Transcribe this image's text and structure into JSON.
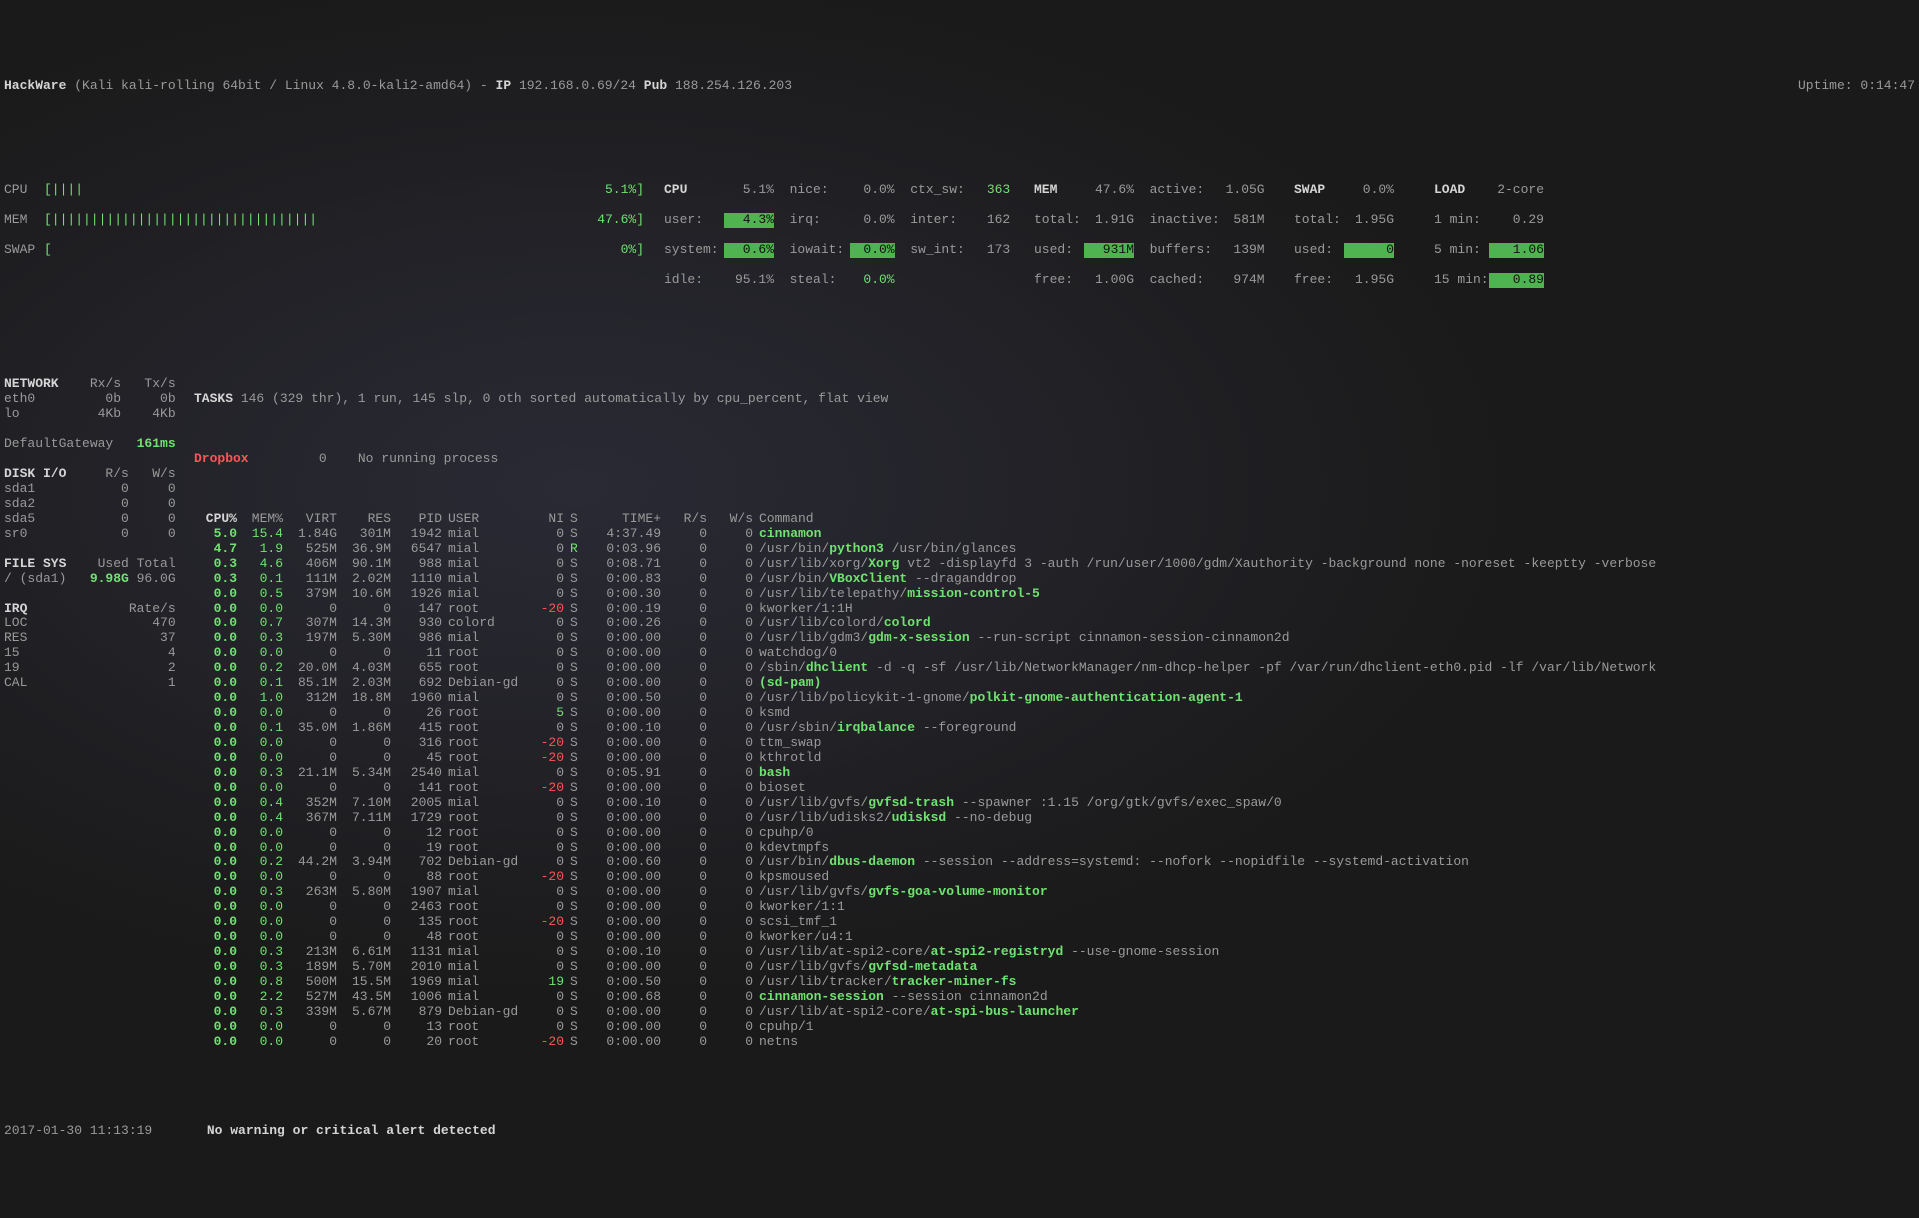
{
  "header": {
    "host": "HackWare",
    "os": "(Kali kali-rolling 64bit / Linux 4.8.0-kali2-amd64)",
    "ip_lbl": "IP",
    "ip": "192.168.0.69/24",
    "pub_lbl": "Pub",
    "pub": "188.254.126.203",
    "uptime_lbl": "Uptime:",
    "uptime": "0:14:47"
  },
  "bars": {
    "cpu": {
      "lbl": "CPU",
      "bar": "[||||",
      "pct": "5.1%]"
    },
    "mem": {
      "lbl": "MEM",
      "bar": "[||||||||||||||||||||||||||||||||||",
      "pct": "47.6%]"
    },
    "swap": {
      "lbl": "SWAP",
      "bar": "[",
      "pct": "0%]"
    }
  },
  "cpu": {
    "hdr": "CPU",
    "tot": "5.1%",
    "user": "user:",
    "user_v": " 4.3%",
    "sys": "system:",
    "sys_v": " 0.6%",
    "idle": "idle:",
    "idle_v": "95.1%",
    "nice": "nice:",
    "nice_v": "0.0%",
    "irq": "irq:",
    "irq_v": "0.0%",
    "iow": "iowait:",
    "iow_v": " 0.0%",
    "steal": "steal:",
    "steal_v": "0.0%",
    "ctx": "ctx_sw:",
    "ctx_v": "363",
    "inter": "inter:",
    "inter_v": "162",
    "swint": "sw_int:",
    "swint_v": "173"
  },
  "mem": {
    "hdr": "MEM",
    "tot": "47.6%",
    "act": "active:",
    "act_v": "1.05G",
    "total": "total:",
    "total_v": "1.91G",
    "inact": "inactive:",
    "inact_v": "581M",
    "used": "used:",
    "used_v": " 931M",
    "buf": "buffers:",
    "buf_v": "139M",
    "free": "free:",
    "free_v": "1.00G",
    "cache": "cached:",
    "cache_v": "974M"
  },
  "swap": {
    "hdr": "SWAP",
    "tot": "0.0%",
    "total": "total:",
    "total_v": "1.95G",
    "used": "used:",
    "used_v": "   0",
    "free": "free:",
    "free_v": "1.95G"
  },
  "load": {
    "hdr": "LOAD",
    "core": "2-core",
    "m1": "1 min:",
    "m1_v": "0.29",
    "m5": "5 min:",
    "m5_v": "1.06",
    "m15": "15 min:",
    "m15_v": "0.89"
  },
  "net": {
    "hdr": "NETWORK",
    "rx": "Rx/s",
    "tx": "Tx/s",
    "ifs": [
      {
        "n": "eth0",
        "r": "0b",
        "t": "0b"
      },
      {
        "n": "lo",
        "r": "4Kb",
        "t": "4Kb"
      }
    ]
  },
  "tasks": {
    "lbl": "TASKS",
    "txt": "146 (329 thr), 1 run, 145 slp, 0 oth sorted automatically by cpu_percent, flat view"
  },
  "dropbox": {
    "lbl": "Dropbox",
    "n": "0",
    "txt": "No running process"
  },
  "gw": {
    "lbl": "DefaultGateway",
    "v": "161ms"
  },
  "disk": {
    "hdr": "DISK I/O",
    "r": "R/s",
    "w": "W/s",
    "rows": [
      {
        "n": "sda1",
        "r": "0",
        "w": "0"
      },
      {
        "n": "sda2",
        "r": "0",
        "w": "0"
      },
      {
        "n": "sda5",
        "r": "0",
        "w": "0"
      },
      {
        "n": "sr0",
        "r": "0",
        "w": "0"
      }
    ]
  },
  "fs": {
    "hdr": "FILE SYS",
    "u": "Used",
    "t": "Total",
    "rows": [
      {
        "n": "/ (sda1)",
        "u": "9.98G",
        "t": "96.0G"
      }
    ]
  },
  "irq": {
    "hdr": "IRQ",
    "rate": "Rate/s",
    "rows": [
      {
        "n": "LOC",
        "v": "470"
      },
      {
        "n": "RES",
        "v": "37"
      },
      {
        "n": "15",
        "v": "4"
      },
      {
        "n": "19",
        "v": "2"
      },
      {
        "n": "CAL",
        "v": "1"
      }
    ]
  },
  "phdr": {
    "cpu": "CPU%",
    "mem": "MEM%",
    "virt": "VIRT",
    "res": "RES",
    "pid": "PID",
    "user": "USER",
    "ni": "NI",
    "s": "S",
    "time": "TIME+",
    "rs": "R/s",
    "ws": "W/s",
    "cmd": "Command"
  },
  "procs": [
    {
      "cpu": "5.0",
      "mem": "15.4",
      "virt": "1.84G",
      "res": "301M",
      "pid": "1942",
      "user": "mial",
      "ni": "0",
      "s": "S",
      "time": "4:37.49",
      "rs": "0",
      "ws": "0",
      "cmd": [
        [
          "g",
          "cinnamon"
        ]
      ]
    },
    {
      "cpu": "4.7",
      "mem": "1.9",
      "virt": "525M",
      "res": "36.9M",
      "pid": "6547",
      "user": "mial",
      "ni": "0",
      "s": "R",
      "time": "0:03.96",
      "rs": "0",
      "ws": "0",
      "cmd": [
        [
          "d",
          "/usr/bin/"
        ],
        [
          "g",
          "python3"
        ],
        [
          "d",
          " /usr/bin/glances"
        ]
      ]
    },
    {
      "cpu": "0.3",
      "mem": "4.6",
      "virt": "406M",
      "res": "90.1M",
      "pid": "988",
      "user": "mial",
      "ni": "0",
      "s": "S",
      "time": "0:08.71",
      "rs": "0",
      "ws": "0",
      "cmd": [
        [
          "d",
          "/usr/lib/xorg/"
        ],
        [
          "g",
          "Xorg"
        ],
        [
          "d",
          " vt2 -displayfd 3 -auth /run/user/1000/gdm/Xauthority -background none -noreset -keeptty -verbose"
        ]
      ]
    },
    {
      "cpu": "0.3",
      "mem": "0.1",
      "virt": "111M",
      "res": "2.02M",
      "pid": "1110",
      "user": "mial",
      "ni": "0",
      "s": "S",
      "time": "0:00.83",
      "rs": "0",
      "ws": "0",
      "cmd": [
        [
          "d",
          "/usr/bin/"
        ],
        [
          "g",
          "VBoxClient"
        ],
        [
          "d",
          " --draganddrop"
        ]
      ]
    },
    {
      "cpu": "0.0",
      "mem": "0.5",
      "virt": "379M",
      "res": "10.6M",
      "pid": "1926",
      "user": "mial",
      "ni": "0",
      "s": "S",
      "time": "0:00.30",
      "rs": "0",
      "ws": "0",
      "cmd": [
        [
          "d",
          "/usr/lib/telepathy/"
        ],
        [
          "g",
          "mission-control-5"
        ]
      ]
    },
    {
      "cpu": "0.0",
      "mem": "0.0",
      "virt": "0",
      "res": "0",
      "pid": "147",
      "user": "root",
      "ni": "-20",
      "s": "S",
      "time": "0:00.19",
      "rs": "0",
      "ws": "0",
      "cmd": [
        [
          "d",
          "kworker/1:1H"
        ]
      ]
    },
    {
      "cpu": "0.0",
      "mem": "0.7",
      "virt": "307M",
      "res": "14.3M",
      "pid": "930",
      "user": "colord",
      "ni": "0",
      "s": "S",
      "time": "0:00.26",
      "rs": "0",
      "ws": "0",
      "cmd": [
        [
          "d",
          "/usr/lib/colord/"
        ],
        [
          "g",
          "colord"
        ]
      ]
    },
    {
      "cpu": "0.0",
      "mem": "0.3",
      "virt": "197M",
      "res": "5.30M",
      "pid": "986",
      "user": "mial",
      "ni": "0",
      "s": "S",
      "time": "0:00.00",
      "rs": "0",
      "ws": "0",
      "cmd": [
        [
          "d",
          "/usr/lib/gdm3/"
        ],
        [
          "g",
          "gdm-x-session"
        ],
        [
          "d",
          " --run-script cinnamon-session-cinnamon2d"
        ]
      ]
    },
    {
      "cpu": "0.0",
      "mem": "0.0",
      "virt": "0",
      "res": "0",
      "pid": "11",
      "user": "root",
      "ni": "0",
      "s": "S",
      "time": "0:00.00",
      "rs": "0",
      "ws": "0",
      "cmd": [
        [
          "d",
          "watchdog/0"
        ]
      ]
    },
    {
      "cpu": "0.0",
      "mem": "0.2",
      "virt": "20.0M",
      "res": "4.03M",
      "pid": "655",
      "user": "root",
      "ni": "0",
      "s": "S",
      "time": "0:00.00",
      "rs": "0",
      "ws": "0",
      "cmd": [
        [
          "d",
          "/sbin/"
        ],
        [
          "g",
          "dhclient"
        ],
        [
          "d",
          " -d -q -sf /usr/lib/NetworkManager/nm-dhcp-helper -pf /var/run/dhclient-eth0.pid -lf /var/lib/Network"
        ]
      ]
    },
    {
      "cpu": "0.0",
      "mem": "0.1",
      "virt": "85.1M",
      "res": "2.03M",
      "pid": "692",
      "user": "Debian-gd",
      "ni": "0",
      "s": "S",
      "time": "0:00.00",
      "rs": "0",
      "ws": "0",
      "cmd": [
        [
          "g",
          "(sd-pam)"
        ]
      ]
    },
    {
      "cpu": "0.0",
      "mem": "1.0",
      "virt": "312M",
      "res": "18.8M",
      "pid": "1960",
      "user": "mial",
      "ni": "0",
      "s": "S",
      "time": "0:00.50",
      "rs": "0",
      "ws": "0",
      "cmd": [
        [
          "d",
          "/usr/lib/policykit-1-gnome/"
        ],
        [
          "g",
          "polkit-gnome-authentication-agent-1"
        ]
      ]
    },
    {
      "cpu": "0.0",
      "mem": "0.0",
      "virt": "0",
      "res": "0",
      "pid": "26",
      "user": "root",
      "ni": "5",
      "s": "S",
      "time": "0:00.00",
      "rs": "0",
      "ws": "0",
      "cmd": [
        [
          "d",
          "ksmd"
        ]
      ]
    },
    {
      "cpu": "0.0",
      "mem": "0.1",
      "virt": "35.0M",
      "res": "1.86M",
      "pid": "415",
      "user": "root",
      "ni": "0",
      "s": "S",
      "time": "0:00.10",
      "rs": "0",
      "ws": "0",
      "cmd": [
        [
          "d",
          "/usr/sbin/"
        ],
        [
          "g",
          "irqbalance"
        ],
        [
          "d",
          " --foreground"
        ]
      ]
    },
    {
      "cpu": "0.0",
      "mem": "0.0",
      "virt": "0",
      "res": "0",
      "pid": "316",
      "user": "root",
      "ni": "-20",
      "s": "S",
      "time": "0:00.00",
      "rs": "0",
      "ws": "0",
      "cmd": [
        [
          "d",
          "ttm_swap"
        ]
      ]
    },
    {
      "cpu": "0.0",
      "mem": "0.0",
      "virt": "0",
      "res": "0",
      "pid": "45",
      "user": "root",
      "ni": "-20",
      "s": "S",
      "time": "0:00.00",
      "rs": "0",
      "ws": "0",
      "cmd": [
        [
          "d",
          "kthrotld"
        ]
      ]
    },
    {
      "cpu": "0.0",
      "mem": "0.3",
      "virt": "21.1M",
      "res": "5.34M",
      "pid": "2540",
      "user": "mial",
      "ni": "0",
      "s": "S",
      "time": "0:05.91",
      "rs": "0",
      "ws": "0",
      "cmd": [
        [
          "g",
          "bash"
        ]
      ]
    },
    {
      "cpu": "0.0",
      "mem": "0.0",
      "virt": "0",
      "res": "0",
      "pid": "141",
      "user": "root",
      "ni": "-20",
      "s": "S",
      "time": "0:00.00",
      "rs": "0",
      "ws": "0",
      "cmd": [
        [
          "d",
          "bioset"
        ]
      ]
    },
    {
      "cpu": "0.0",
      "mem": "0.4",
      "virt": "352M",
      "res": "7.10M",
      "pid": "2005",
      "user": "mial",
      "ni": "0",
      "s": "S",
      "time": "0:00.10",
      "rs": "0",
      "ws": "0",
      "cmd": [
        [
          "d",
          "/usr/lib/gvfs/"
        ],
        [
          "g",
          "gvfsd-trash"
        ],
        [
          "d",
          " --spawner :1.15 /org/gtk/gvfs/exec_spaw/0"
        ]
      ]
    },
    {
      "cpu": "0.0",
      "mem": "0.4",
      "virt": "367M",
      "res": "7.11M",
      "pid": "1729",
      "user": "root",
      "ni": "0",
      "s": "S",
      "time": "0:00.00",
      "rs": "0",
      "ws": "0",
      "cmd": [
        [
          "d",
          "/usr/lib/udisks2/"
        ],
        [
          "g",
          "udisksd"
        ],
        [
          "d",
          " --no-debug"
        ]
      ]
    },
    {
      "cpu": "0.0",
      "mem": "0.0",
      "virt": "0",
      "res": "0",
      "pid": "12",
      "user": "root",
      "ni": "0",
      "s": "S",
      "time": "0:00.00",
      "rs": "0",
      "ws": "0",
      "cmd": [
        [
          "d",
          "cpuhp/0"
        ]
      ]
    },
    {
      "cpu": "0.0",
      "mem": "0.0",
      "virt": "0",
      "res": "0",
      "pid": "19",
      "user": "root",
      "ni": "0",
      "s": "S",
      "time": "0:00.00",
      "rs": "0",
      "ws": "0",
      "cmd": [
        [
          "d",
          "kdevtmpfs"
        ]
      ]
    },
    {
      "cpu": "0.0",
      "mem": "0.2",
      "virt": "44.2M",
      "res": "3.94M",
      "pid": "702",
      "user": "Debian-gd",
      "ni": "0",
      "s": "S",
      "time": "0:00.60",
      "rs": "0",
      "ws": "0",
      "cmd": [
        [
          "d",
          "/usr/bin/"
        ],
        [
          "g",
          "dbus-daemon"
        ],
        [
          "d",
          " --session --address=systemd: --nofork --nopidfile --systemd-activation"
        ]
      ]
    },
    {
      "cpu": "0.0",
      "mem": "0.0",
      "virt": "0",
      "res": "0",
      "pid": "88",
      "user": "root",
      "ni": "-20",
      "s": "S",
      "time": "0:00.00",
      "rs": "0",
      "ws": "0",
      "cmd": [
        [
          "d",
          "kpsmoused"
        ]
      ]
    },
    {
      "cpu": "0.0",
      "mem": "0.3",
      "virt": "263M",
      "res": "5.80M",
      "pid": "1907",
      "user": "mial",
      "ni": "0",
      "s": "S",
      "time": "0:00.00",
      "rs": "0",
      "ws": "0",
      "cmd": [
        [
          "d",
          "/usr/lib/gvfs/"
        ],
        [
          "g",
          "gvfs-goa-volume-monitor"
        ]
      ]
    },
    {
      "cpu": "0.0",
      "mem": "0.0",
      "virt": "0",
      "res": "0",
      "pid": "2463",
      "user": "root",
      "ni": "0",
      "s": "S",
      "time": "0:00.00",
      "rs": "0",
      "ws": "0",
      "cmd": [
        [
          "d",
          "kworker/1:1"
        ]
      ]
    },
    {
      "cpu": "0.0",
      "mem": "0.0",
      "virt": "0",
      "res": "0",
      "pid": "135",
      "user": "root",
      "ni": "-20",
      "s": "S",
      "time": "0:00.00",
      "rs": "0",
      "ws": "0",
      "cmd": [
        [
          "d",
          "scsi_tmf_1"
        ]
      ]
    },
    {
      "cpu": "0.0",
      "mem": "0.0",
      "virt": "0",
      "res": "0",
      "pid": "48",
      "user": "root",
      "ni": "0",
      "s": "S",
      "time": "0:00.00",
      "rs": "0",
      "ws": "0",
      "cmd": [
        [
          "d",
          "kworker/u4:1"
        ]
      ]
    },
    {
      "cpu": "0.0",
      "mem": "0.3",
      "virt": "213M",
      "res": "6.61M",
      "pid": "1131",
      "user": "mial",
      "ni": "0",
      "s": "S",
      "time": "0:00.10",
      "rs": "0",
      "ws": "0",
      "cmd": [
        [
          "d",
          "/usr/lib/at-spi2-core/"
        ],
        [
          "g",
          "at-spi2-registryd"
        ],
        [
          "d",
          " --use-gnome-session"
        ]
      ]
    },
    {
      "cpu": "0.0",
      "mem": "0.3",
      "virt": "189M",
      "res": "5.70M",
      "pid": "2010",
      "user": "mial",
      "ni": "0",
      "s": "S",
      "time": "0:00.00",
      "rs": "0",
      "ws": "0",
      "cmd": [
        [
          "d",
          "/usr/lib/gvfs/"
        ],
        [
          "g",
          "gvfsd-metadata"
        ]
      ]
    },
    {
      "cpu": "0.0",
      "mem": "0.8",
      "virt": "500M",
      "res": "15.5M",
      "pid": "1969",
      "user": "mial",
      "ni": "19",
      "s": "S",
      "time": "0:00.50",
      "rs": "0",
      "ws": "0",
      "cmd": [
        [
          "d",
          "/usr/lib/tracker/"
        ],
        [
          "g",
          "tracker-miner-fs"
        ]
      ]
    },
    {
      "cpu": "0.0",
      "mem": "2.2",
      "virt": "527M",
      "res": "43.5M",
      "pid": "1006",
      "user": "mial",
      "ni": "0",
      "s": "S",
      "time": "0:00.68",
      "rs": "0",
      "ws": "0",
      "cmd": [
        [
          "g",
          "cinnamon-session"
        ],
        [
          "d",
          " --session cinnamon2d"
        ]
      ]
    },
    {
      "cpu": "0.0",
      "mem": "0.3",
      "virt": "339M",
      "res": "5.67M",
      "pid": "879",
      "user": "Debian-gd",
      "ni": "0",
      "s": "S",
      "time": "0:00.00",
      "rs": "0",
      "ws": "0",
      "cmd": [
        [
          "d",
          "/usr/lib/at-spi2-core/"
        ],
        [
          "g",
          "at-spi-bus-launcher"
        ]
      ]
    },
    {
      "cpu": "0.0",
      "mem": "0.0",
      "virt": "0",
      "res": "0",
      "pid": "13",
      "user": "root",
      "ni": "0",
      "s": "S",
      "time": "0:00.00",
      "rs": "0",
      "ws": "0",
      "cmd": [
        [
          "d",
          "cpuhp/1"
        ]
      ]
    },
    {
      "cpu": "0.0",
      "mem": "0.0",
      "virt": "0",
      "res": "0",
      "pid": "20",
      "user": "root",
      "ni": "-20",
      "s": "S",
      "time": "0:00.00",
      "rs": "0",
      "ws": "0",
      "cmd": [
        [
          "d",
          "netns"
        ]
      ]
    }
  ],
  "footer": {
    "date": "2017-01-30 11:13:19",
    "alert": "No warning or critical alert detected"
  }
}
